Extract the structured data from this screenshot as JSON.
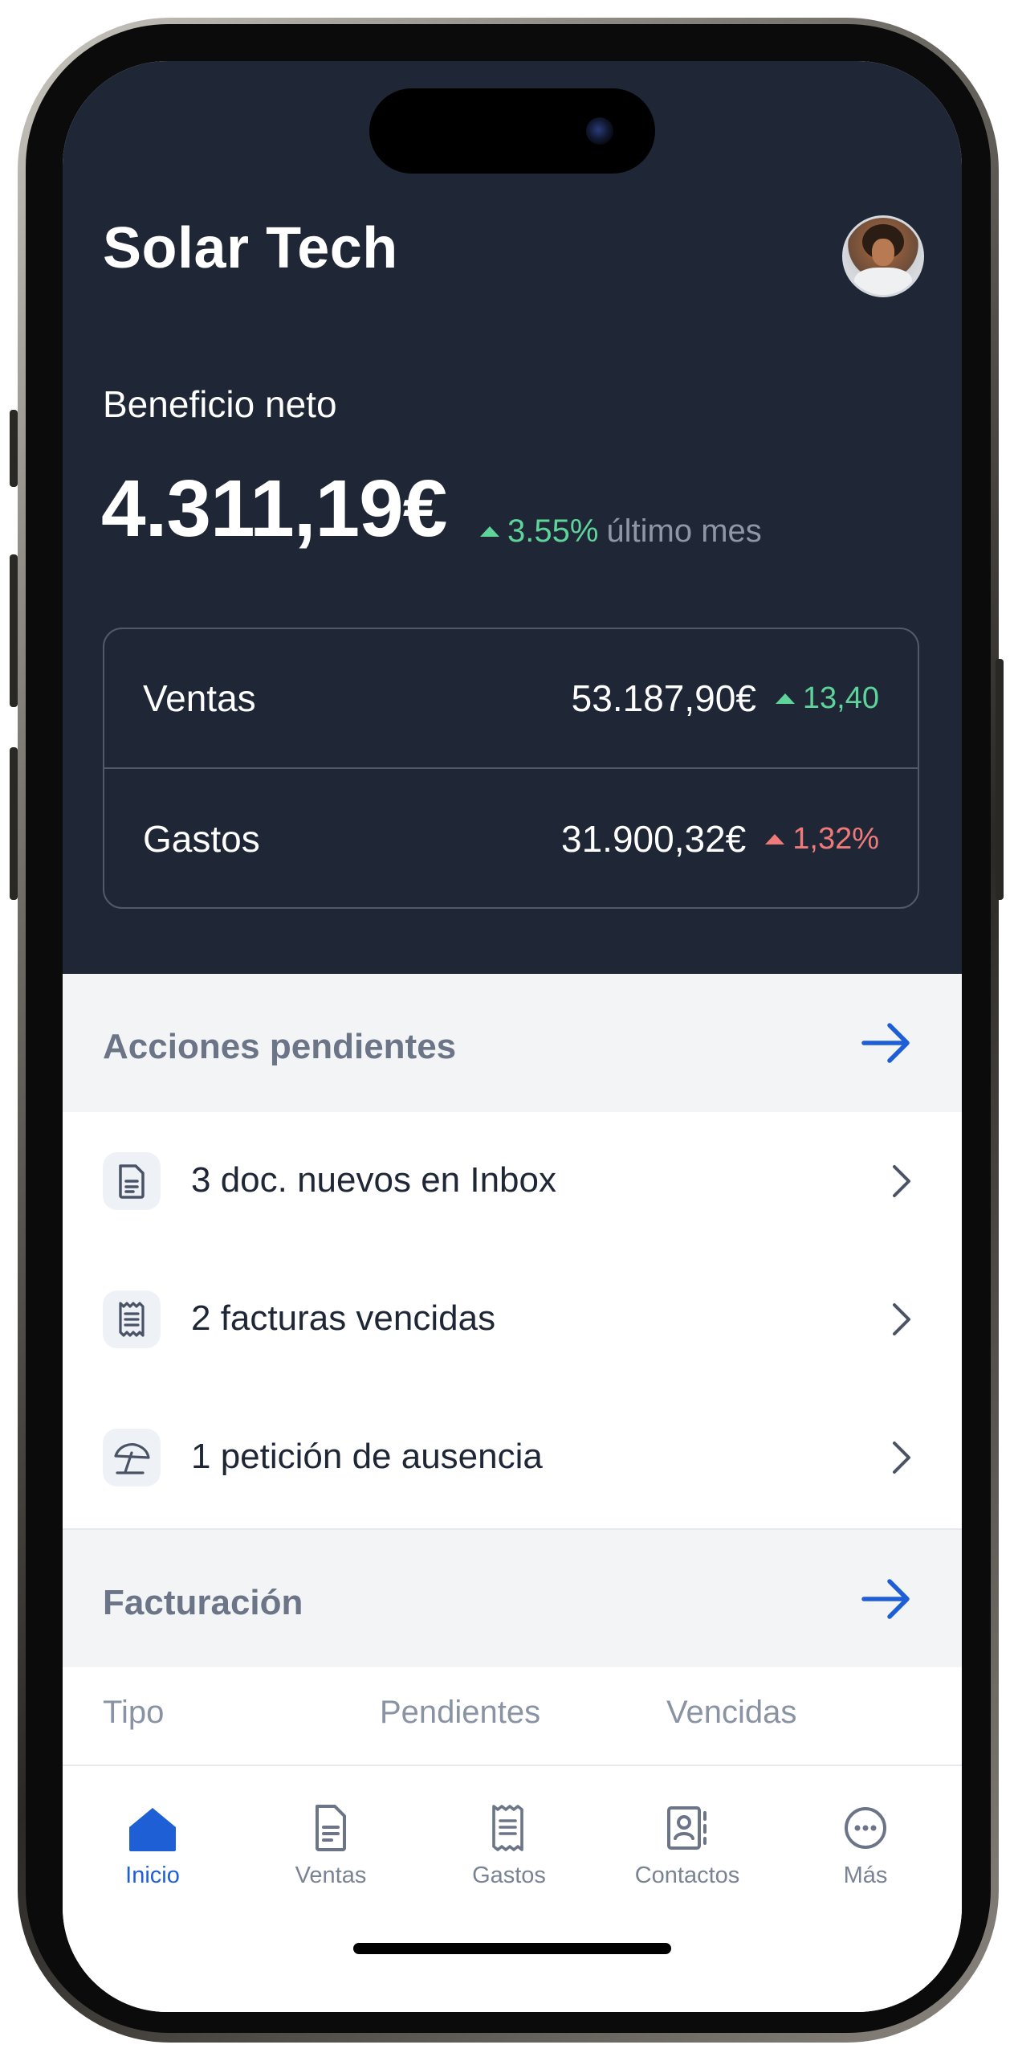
{
  "company": {
    "name": "Solar Tech"
  },
  "profit": {
    "label": "Beneficio neto",
    "value": "4.311,19€",
    "delta": "3.55%",
    "period": "último mes"
  },
  "summary": [
    {
      "label": "Ventas",
      "amount": "53.187,90€",
      "delta": "13,40",
      "trend": "up",
      "color": "#5ed39a"
    },
    {
      "label": "Gastos",
      "amount": "31.900,32€",
      "delta": "1,32%",
      "trend": "up",
      "color": "#f07a7a"
    }
  ],
  "pending": {
    "title": "Acciones pendientes",
    "items": [
      {
        "label": "3 doc. nuevos en Inbox",
        "icon": "document-icon"
      },
      {
        "label": "2 facturas vencidas",
        "icon": "receipt-icon"
      },
      {
        "label": "1 petición de ausencia",
        "icon": "beach-umbrella-icon"
      }
    ]
  },
  "billing": {
    "title": "Facturación",
    "columns": [
      "Tipo",
      "Pendientes",
      "Vencidas"
    ]
  },
  "tabbar": {
    "active": "Inicio",
    "items": [
      {
        "label": "Inicio",
        "icon": "home-icon"
      },
      {
        "label": "Ventas",
        "icon": "document-icon"
      },
      {
        "label": "Gastos",
        "icon": "receipt-icon"
      },
      {
        "label": "Contactos",
        "icon": "contacts-icon"
      },
      {
        "label": "Más",
        "icon": "more-icon"
      }
    ]
  },
  "colors": {
    "header_bg": "#1f2737",
    "accent": "#1f5fd6",
    "positive": "#5ed39a",
    "negative": "#f07a7a"
  }
}
